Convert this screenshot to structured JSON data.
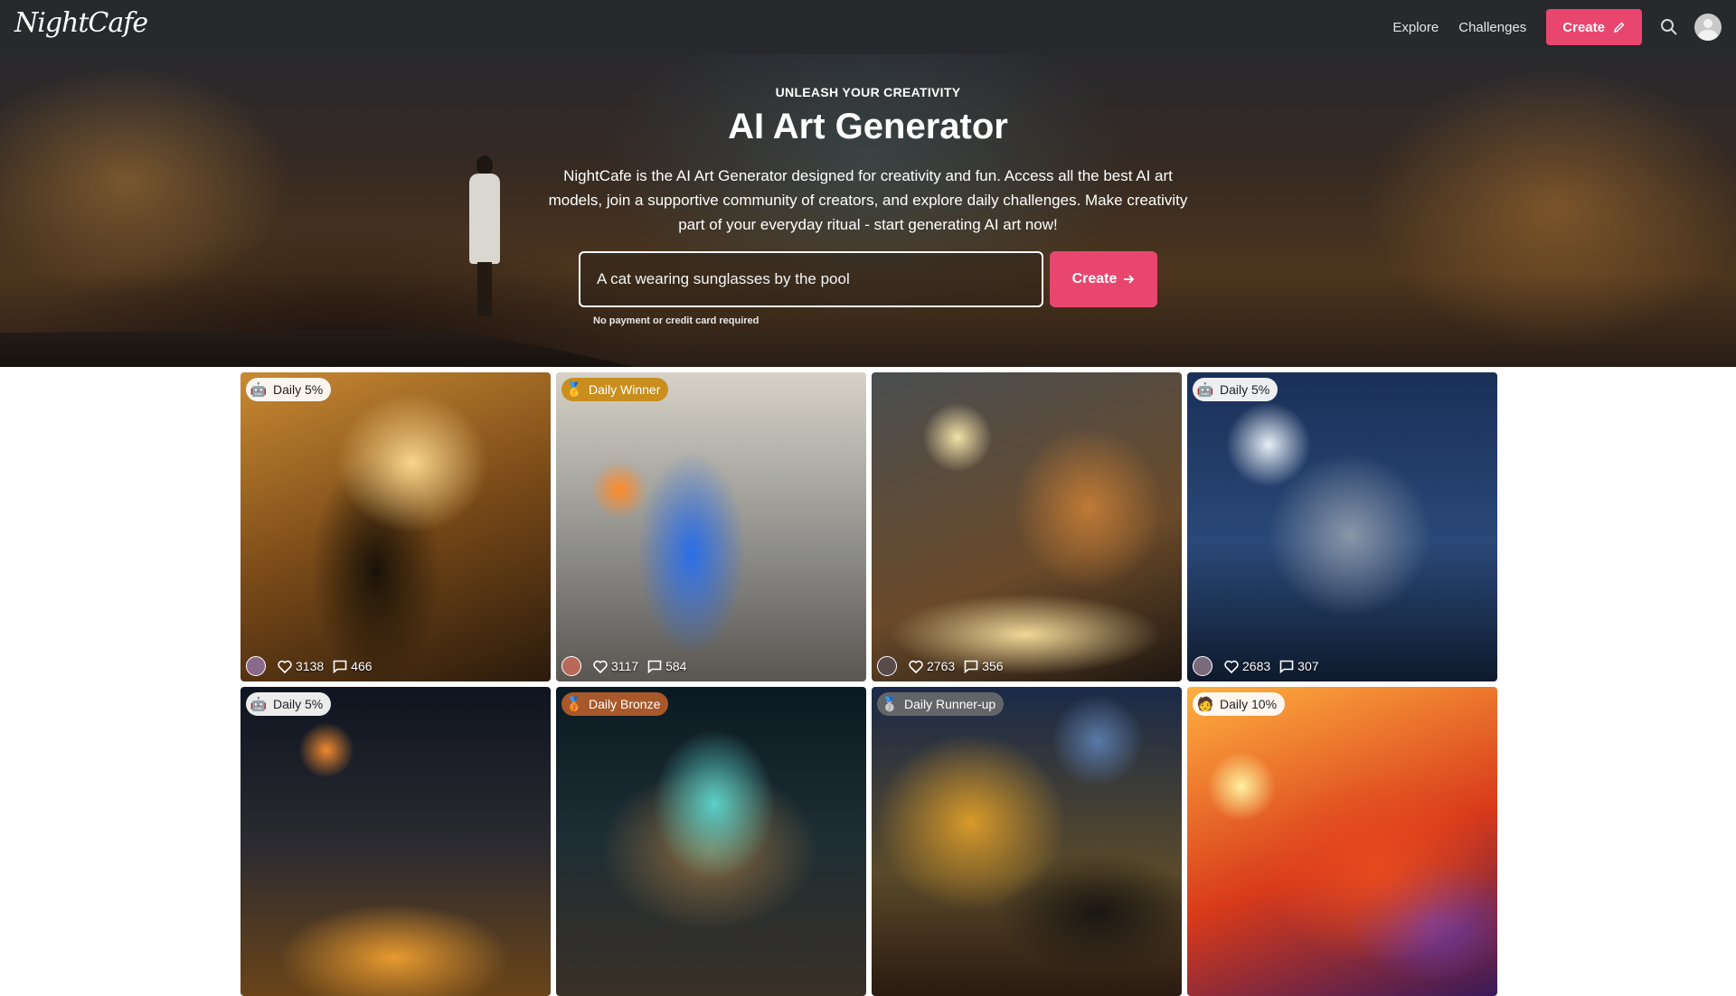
{
  "nav": {
    "logo": "NightCafe",
    "links": [
      "Explore",
      "Challenges"
    ],
    "create_label": "Create"
  },
  "hero": {
    "eyebrow": "UNLEASH YOUR CREATIVITY",
    "title": "AI Art Generator",
    "description": "NightCafe is the AI Art Generator designed for creativity and fun. Access all the best AI art models, join a supportive community of creators, and explore daily challenges. Make creativity part of your everyday ritual - start generating AI art now!",
    "prompt_value": "A cat wearing sunglasses by the pool",
    "create_label": "Create",
    "note": "No payment or credit card required"
  },
  "cards": [
    {
      "badge": "Daily 5%",
      "badge_icon": "robot-icon",
      "likes": "3138",
      "comments": "466"
    },
    {
      "badge": "Daily Winner",
      "badge_icon": "gold-medal-icon",
      "likes": "3117",
      "comments": "584"
    },
    {
      "badge": "",
      "badge_icon": "",
      "likes": "2763",
      "comments": "356"
    },
    {
      "badge": "Daily 5%",
      "badge_icon": "robot-icon",
      "likes": "2683",
      "comments": "307"
    },
    {
      "badge": "Daily 5%",
      "badge_icon": "robot-icon",
      "likes": "",
      "comments": ""
    },
    {
      "badge": "Daily Bronze",
      "badge_icon": "bronze-medal-icon",
      "likes": "",
      "comments": ""
    },
    {
      "badge": "Daily Runner-up",
      "badge_icon": "silver-medal-icon",
      "likes": "",
      "comments": ""
    },
    {
      "badge": "Daily 10%",
      "badge_icon": "person-icon",
      "likes": "",
      "comments": ""
    }
  ],
  "colors": {
    "nav_bg": "#27292d",
    "accent": "#e8466e"
  }
}
